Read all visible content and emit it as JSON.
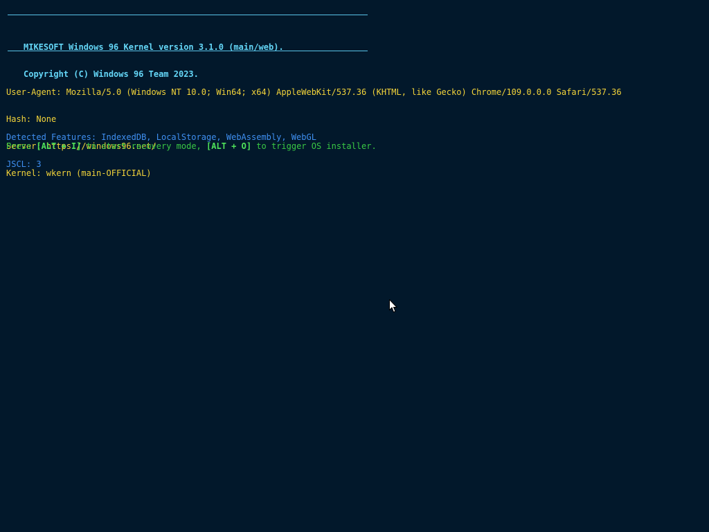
{
  "colors": {
    "background": "#02182b",
    "banner": "#64d6f7",
    "rule": "#59c3e8",
    "info": "#f2d33a",
    "features": "#3f8ff0",
    "prompt": "#39c844"
  },
  "banner": {
    "line1": "MIKESOFT Windows 96 Kernel version 3.1.0 (main/web).",
    "line2": "Copyright (C) Windows 96 Team 2023."
  },
  "info": {
    "user_agent": "User-Agent: Mozilla/5.0 (Windows NT 10.0; Win64; x64) AppleWebKit/537.36 (KHTML, like Gecko) Chrome/109.0.0.0 Safari/537.36",
    "hash": "Hash: None",
    "server": "Server: https://windows96.net/",
    "kernel": "Kernel: wkern (main-OFFICIAL)"
  },
  "features": {
    "detected": "Detected Features: IndexedDB, LocalStorage, WebAssembly, WebGL",
    "jscl": "JSCL: 3"
  },
  "prompt": {
    "press": "Press ",
    "key_recovery": "[ALT + I]",
    "middle": " to start recovery mode, ",
    "key_installer": "[ALT + O]",
    "end": " to trigger OS installer."
  },
  "cursor_icon": "mouse-pointer-icon"
}
